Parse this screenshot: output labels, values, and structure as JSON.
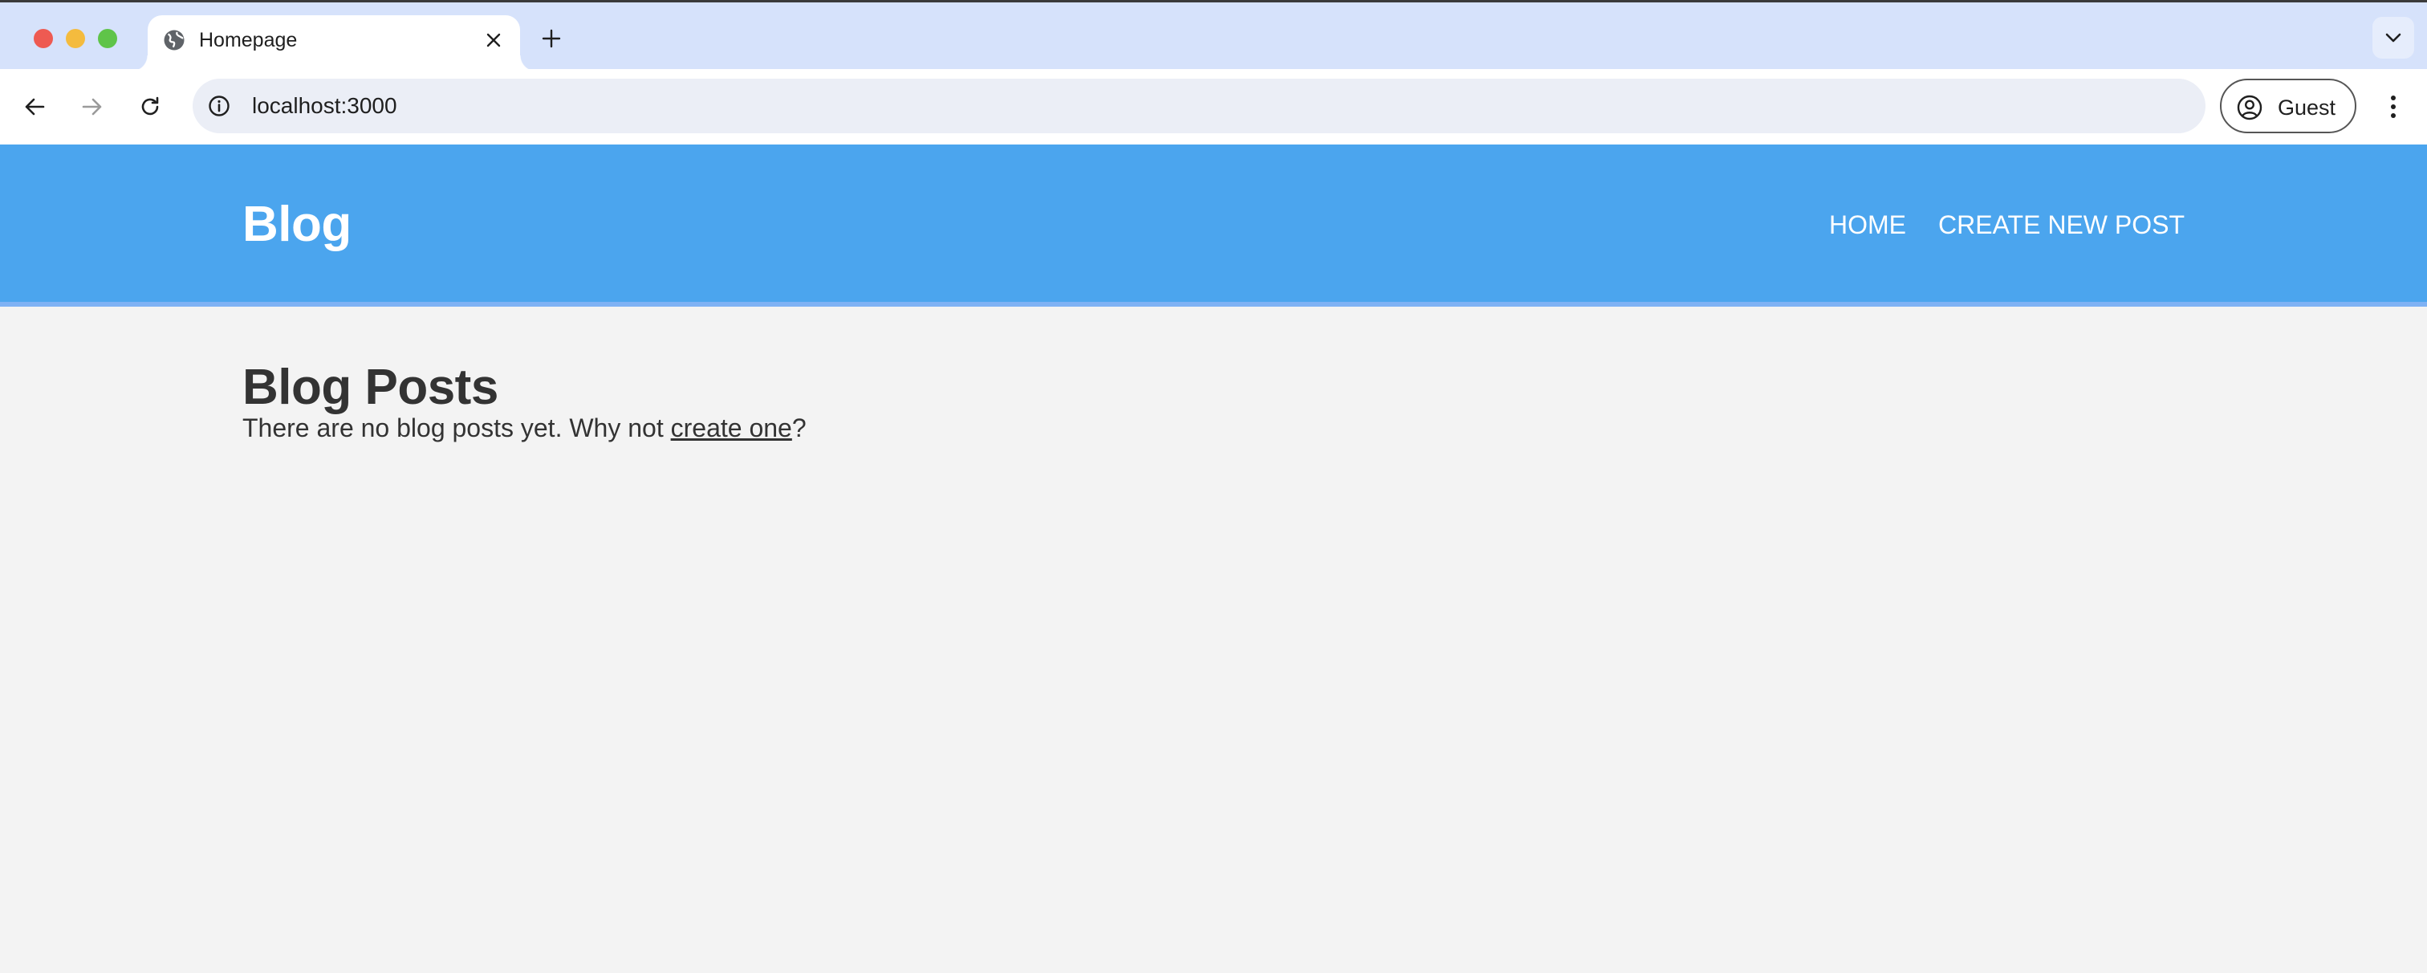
{
  "browser": {
    "tab": {
      "title": "Homepage",
      "favicon": "globe-icon"
    },
    "address_bar": {
      "url": "localhost:3000"
    },
    "profile": {
      "label": "Guest"
    }
  },
  "site": {
    "brand": "Blog",
    "nav": [
      {
        "label": "HOME"
      },
      {
        "label": "CREATE NEW POST"
      }
    ],
    "header_color": "#4ba5ee"
  },
  "main": {
    "title": "Blog Posts",
    "empty_message_prefix": "There are no blog posts yet. Why not ",
    "empty_message_link": "create one",
    "empty_message_suffix": "?"
  }
}
